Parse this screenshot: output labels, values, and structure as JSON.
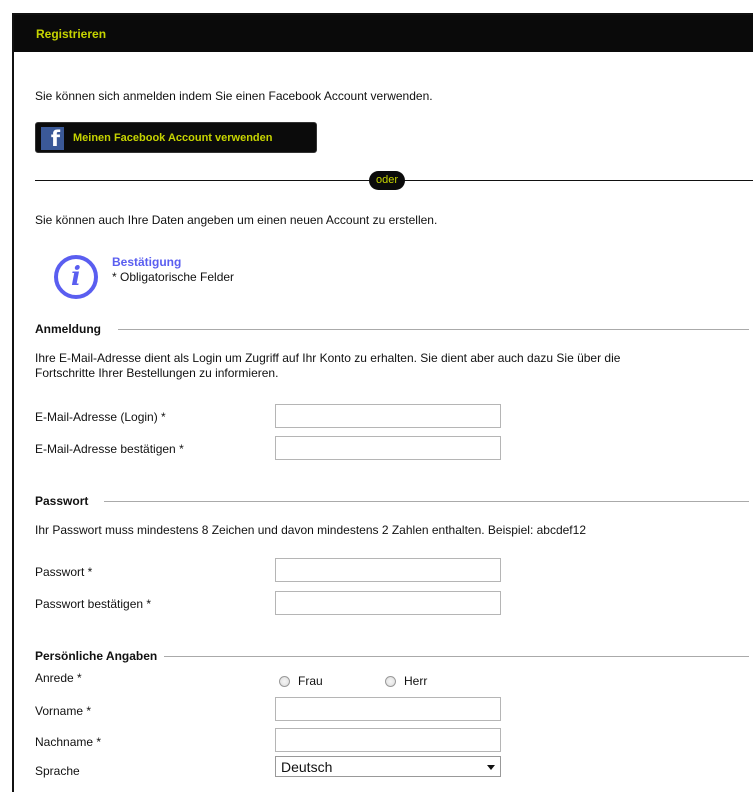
{
  "header": {
    "title": "Registrieren"
  },
  "facebook": {
    "intro": "Sie können sich anmelden indem Sie einen Facebook Account verwenden.",
    "button_label": "Meinen Facebook Account verwenden",
    "logo_letter": "f"
  },
  "divider": {
    "label": "oder"
  },
  "create_intro": "Sie können auch Ihre Daten angeben um einen neuen Account zu erstellen.",
  "info": {
    "icon_glyph": "i",
    "title": "Bestätigung",
    "note": "* Obligatorische Felder"
  },
  "sections": {
    "login": {
      "legend": "Anmeldung",
      "description_line1": "Ihre E-Mail-Adresse dient als Login um Zugriff auf Ihr Konto zu erhalten. Sie dient aber auch dazu Sie über die",
      "description_line2": "Fortschritte Ihrer Bestellungen zu informieren.",
      "email_label": "E-Mail-Adresse (Login) *",
      "email_value": "",
      "email_confirm_label": "E-Mail-Adresse bestätigen *",
      "email_confirm_value": ""
    },
    "password": {
      "legend": "Passwort",
      "description": "Ihr Passwort muss mindestens 8 Zeichen und davon mindestens 2 Zahlen enthalten. Beispiel: abcdef12",
      "password_label": "Passwort *",
      "password_value": "",
      "password_confirm_label": "Passwort bestätigen *",
      "password_confirm_value": ""
    },
    "personal": {
      "legend": "Persönliche Angaben",
      "salutation_label": "Anrede  *",
      "salutation_options": [
        "Frau",
        "Herr"
      ],
      "firstname_label": "Vorname *",
      "firstname_value": "",
      "lastname_label": "Nachname *",
      "lastname_value": "",
      "language_label": "Sprache",
      "language_selected": "Deutsch"
    }
  }
}
